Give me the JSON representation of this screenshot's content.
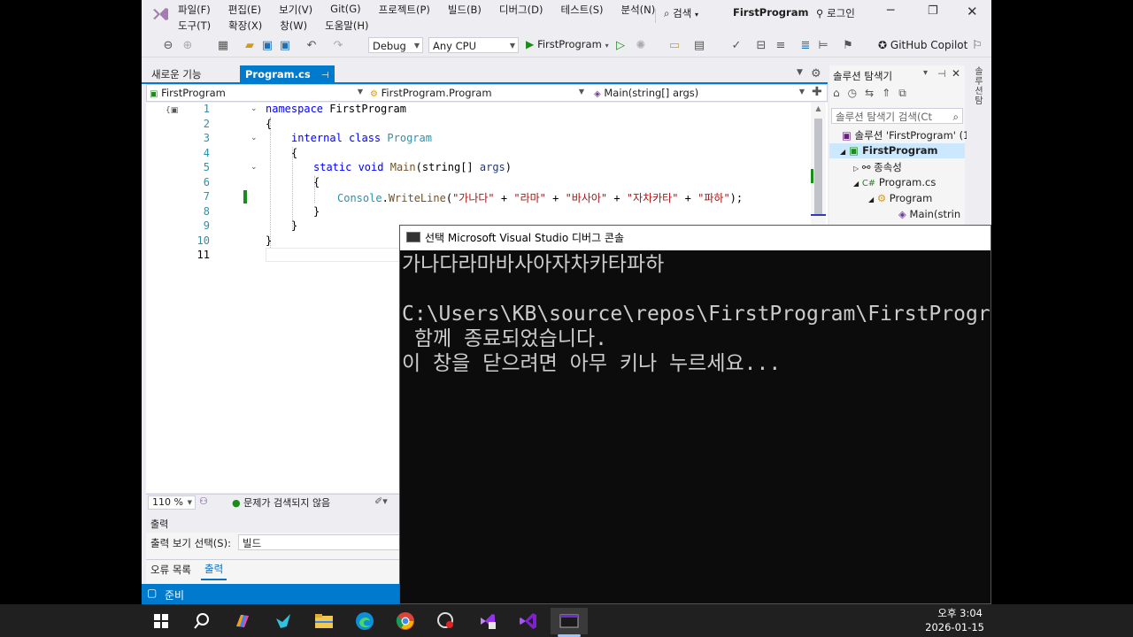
{
  "vs": {
    "menu_row1": [
      "파일(F)",
      "편집(E)",
      "보기(V)",
      "Git(G)",
      "프로젝트(P)",
      "빌드(B)",
      "디버그(D)",
      "테스트(S)",
      "분석(N)"
    ],
    "menu_row2": [
      "도구(T)",
      "확장(X)",
      "창(W)",
      "도움말(H)"
    ],
    "search_label": "검색",
    "solution_title": "FirstProgram",
    "login_label": "로그인",
    "config": "Debug",
    "platform": "Any CPU",
    "run_target": "FirstProgram",
    "copilot": "GitHub Copilot",
    "tabs": {
      "feature": "새로운 기능",
      "file": "Program.cs"
    },
    "nav": {
      "project": "FirstProgram",
      "class": "FirstProgram.Program",
      "member": "Main(string[] args)"
    },
    "line_numbers": [
      "1",
      "2",
      "3",
      "4",
      "5",
      "6",
      "7",
      "8",
      "9",
      "10",
      "11"
    ],
    "code": {
      "l1_kw": "namespace",
      "l1_rest": " FirstProgram",
      "l2": "{",
      "l3_kw": "internal class",
      "l3_ty": "Program",
      "l4": "{",
      "l5_kw": "static void",
      "l5_fn": "Main",
      "l5_a": "(string[] ",
      "l5_b": "args",
      "l5_c": ")",
      "l6": "{",
      "l7_ty": "Console",
      "l7_dot": ".",
      "l7_fn": "WriteLine",
      "l7_open": "(",
      "l7_s1": "\"가나다\"",
      "l7_plus": " + ",
      "l7_s2": "\"라마\"",
      "l7_s3": "\"바사아\"",
      "l7_s4": "\"자차카타\"",
      "l7_s5": "\"파하\"",
      "l7_close": ");",
      "l8": "}",
      "l9": "}",
      "l10": "}"
    },
    "zoom": "110 %",
    "issues": "문제가 검색되지 않음",
    "output": {
      "title": "출력",
      "source_label": "출력 보기 선택(S):",
      "source_value": "빌드",
      "tab_errors": "오류 목록",
      "tab_output": "출력"
    },
    "status": "준비",
    "solution_explorer": {
      "title": "솔루션 탐색기",
      "search_placeholder": "솔루션 탐색기 검색(Ct",
      "items": [
        "솔루션 'FirstProgram' (1",
        "FirstProgram",
        "종속성",
        "Program.cs",
        "Program",
        "Main(strin"
      ]
    }
  },
  "console": {
    "title": "선택 Microsoft Visual Studio 디버그 콘솔",
    "lines": [
      "가나다라마바사아자차카타파하",
      "",
      "C:\\Users\\KB\\source\\repos\\FirstProgram\\FirstProgr",
      " 함께 종료되었습니다.",
      "이 창을 닫으려면 아무 키나 누르세요..."
    ]
  },
  "taskbar": {
    "time": "오후 3:04",
    "date": "2026-01-15"
  },
  "colors": {
    "accent": "#007acc",
    "keyword": "#0000ff",
    "type": "#2b91af",
    "string": "#a31515"
  }
}
